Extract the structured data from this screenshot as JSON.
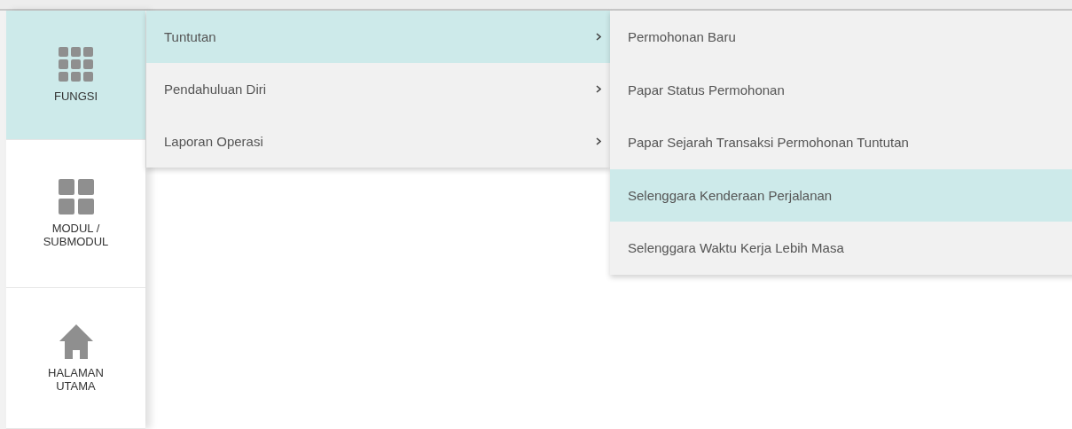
{
  "sidebar": {
    "items": [
      {
        "label": "FUNGSI",
        "selected": true
      },
      {
        "label": "MODUL / SUBMODUL",
        "selected": false
      },
      {
        "label": "HALAMAN UTAMA",
        "selected": false
      }
    ]
  },
  "menu": {
    "items": [
      {
        "label": "Tuntutan",
        "selected": true,
        "has_submenu": true
      },
      {
        "label": "Pendahuluan Diri",
        "selected": false,
        "has_submenu": true
      },
      {
        "label": "Laporan Operasi",
        "selected": false,
        "has_submenu": true
      }
    ]
  },
  "submenu": {
    "items": [
      {
        "label": "Permohonan Baru",
        "selected": false
      },
      {
        "label": "Papar Status Permohonan",
        "selected": false
      },
      {
        "label": "Papar Sejarah Transaksi Permohonan Tuntutan",
        "selected": false
      },
      {
        "label": "Selenggara Kenderaan Perjalanan",
        "selected": true
      },
      {
        "label": "Selenggara Waktu Kerja Lebih Masa",
        "selected": false
      }
    ]
  }
}
